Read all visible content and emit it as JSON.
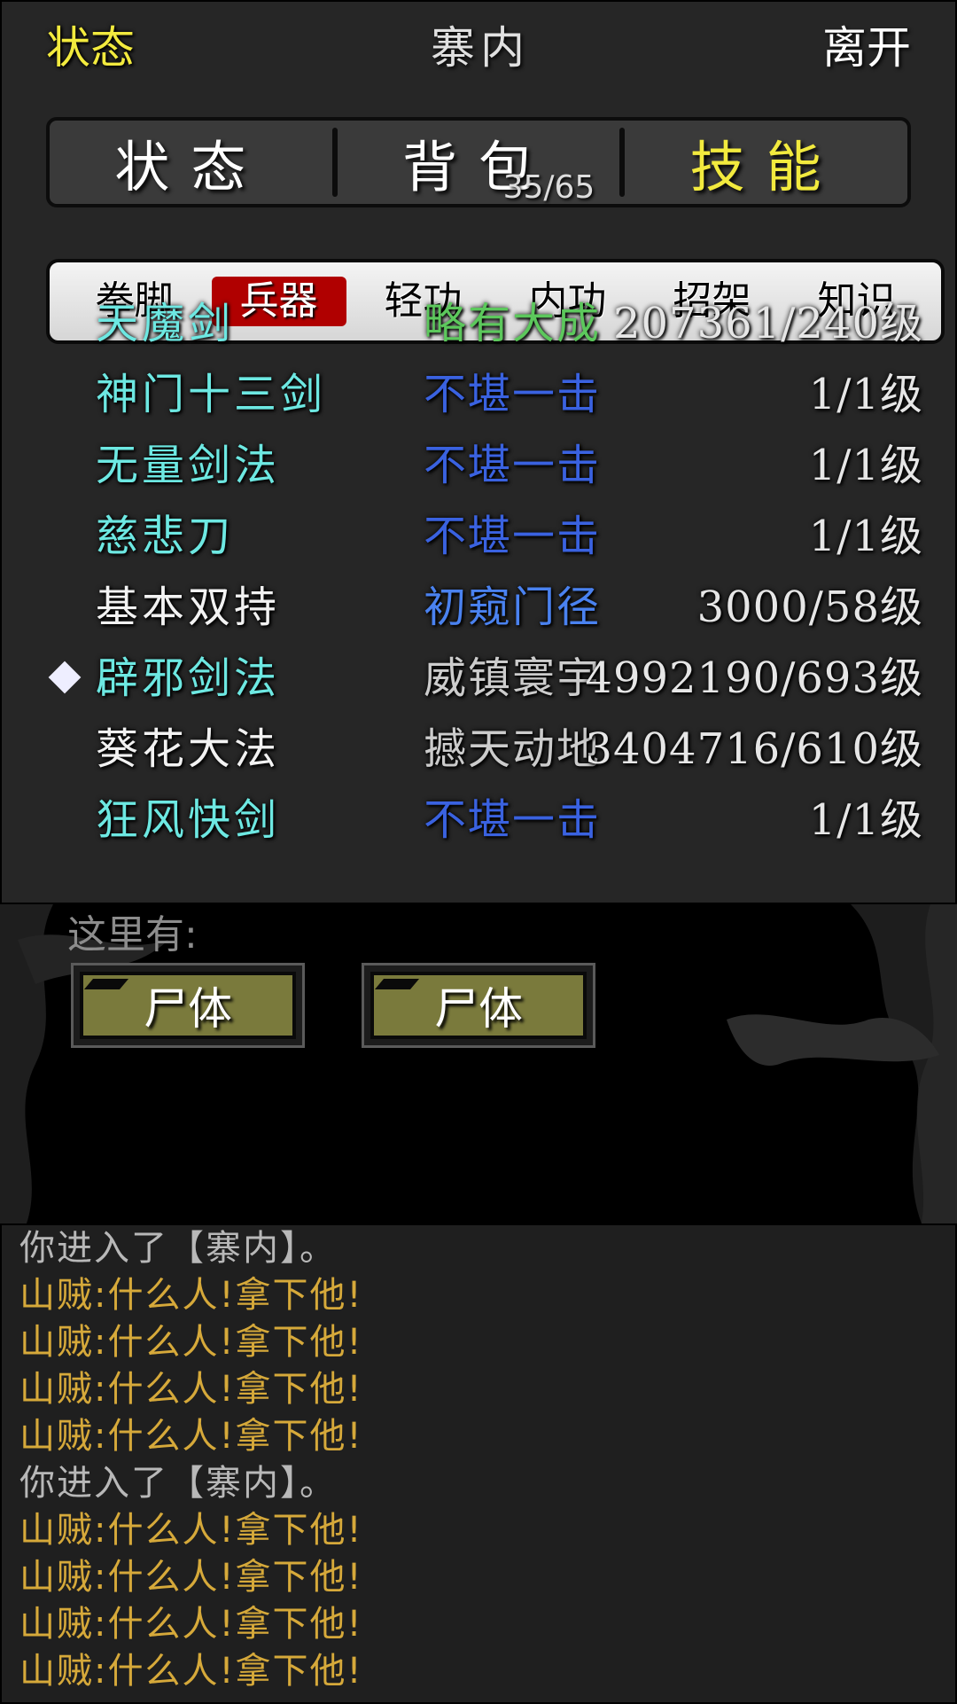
{
  "header": {
    "left_label": "状态",
    "title": "寨内",
    "right_label": "离开"
  },
  "main_tabs": [
    {
      "label": "状态",
      "badge": ""
    },
    {
      "label": "背包",
      "badge": "35/65"
    },
    {
      "label": "技能",
      "badge": ""
    }
  ],
  "active_main_tab": 2,
  "sub_tabs": [
    "拳脚",
    "兵器",
    "轻功",
    "内功",
    "招架",
    "知识"
  ],
  "active_sub_tab": 1,
  "skills": [
    {
      "name": "天魔剑",
      "level": "略有大成",
      "value": "207361/240级",
      "name_color": "#6de8e2",
      "level_color": "#5cc85c",
      "partial": true
    },
    {
      "name": "神门十三剑",
      "level": "不堪一击",
      "value": "1/1级",
      "name_color": "#6de8e2",
      "level_color": "#3a62e0"
    },
    {
      "name": "无量剑法",
      "level": "不堪一击",
      "value": "1/1级",
      "name_color": "#6de8e2",
      "level_color": "#3a62e0"
    },
    {
      "name": "慈悲刀",
      "level": "不堪一击",
      "value": "1/1级",
      "name_color": "#6de8e2",
      "level_color": "#3a62e0"
    },
    {
      "name": "基本双持",
      "level": "初窥门径",
      "value": "3000/58级",
      "name_color": "#f2f2f2",
      "level_color": "#4a82f0"
    },
    {
      "name": "辟邪剑法",
      "level": "威镇寰宇",
      "value": "4992190/693级",
      "name_color": "#6de8e2",
      "level_color": "#cccccc",
      "equipped": true
    },
    {
      "name": "葵花大法",
      "level": "撼天动地",
      "value": "3404716/610级",
      "name_color": "#f2f2f2",
      "level_color": "#cccccc"
    },
    {
      "name": "狂风快剑",
      "level": "不堪一击",
      "value": "1/1级",
      "name_color": "#6de8e2",
      "level_color": "#3a62e0"
    }
  ],
  "map": {
    "here_label": "这里有:",
    "objects": [
      "尸体",
      "尸体"
    ]
  },
  "log": [
    {
      "text": "你进入了【寨内】。",
      "color": "#b8b8b8"
    },
    {
      "text": "山贼:什么人!拿下他!",
      "color": "#d6a93a"
    },
    {
      "text": "山贼:什么人!拿下他!",
      "color": "#d6a93a"
    },
    {
      "text": "山贼:什么人!拿下他!",
      "color": "#d6a93a"
    },
    {
      "text": "山贼:什么人!拿下他!",
      "color": "#d6a93a"
    },
    {
      "text": "你进入了【寨内】。",
      "color": "#b8b8b8"
    },
    {
      "text": "山贼:什么人!拿下他!",
      "color": "#d6a93a"
    },
    {
      "text": "山贼:什么人!拿下他!",
      "color": "#d6a93a"
    },
    {
      "text": "山贼:什么人!拿下他!",
      "color": "#d6a93a"
    },
    {
      "text": "山贼:什么人!拿下他!",
      "color": "#d6a93a"
    }
  ]
}
